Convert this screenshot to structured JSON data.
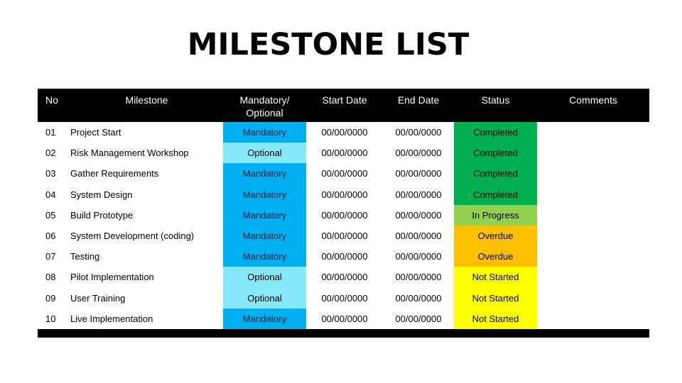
{
  "title": "MILESTONE LIST",
  "colors": {
    "header_bg": "#000000",
    "mandatory": "#00b0f0",
    "optional": "#87e8f7",
    "completed": "#00b050",
    "in_progress": "#92d050",
    "overdue": "#ffc000",
    "not_started": "#ffff00"
  },
  "headers": {
    "no": "No",
    "milestone": "Milestone",
    "mandatory_optional_1": "Mandatory/",
    "mandatory_optional_2": "Optional",
    "start_date": "Start Date",
    "end_date": "End Date",
    "status": "Status",
    "comments": "Comments"
  },
  "rows": [
    {
      "no": "01",
      "milestone": "Project Start",
      "type": "Mandatory",
      "start": "00/00/0000",
      "end": "00/00/0000",
      "status": "Completed",
      "comments": ""
    },
    {
      "no": "02",
      "milestone": "Risk Management Workshop",
      "type": "Optional",
      "start": "00/00/0000",
      "end": "00/00/0000",
      "status": "Completed",
      "comments": ""
    },
    {
      "no": "03",
      "milestone": "Gather Requirements",
      "type": "Mandatory",
      "start": "00/00/0000",
      "end": "00/00/0000",
      "status": "Completed",
      "comments": ""
    },
    {
      "no": "04",
      "milestone": "System Design",
      "type": "Mandatory",
      "start": "00/00/0000",
      "end": "00/00/0000",
      "status": "Completed",
      "comments": ""
    },
    {
      "no": "05",
      "milestone": "Build Prototype",
      "type": "Mandatory",
      "start": "00/00/0000",
      "end": "00/00/0000",
      "status": "In Progress",
      "comments": ""
    },
    {
      "no": "06",
      "milestone": "System Development (coding)",
      "type": "Mandatory",
      "start": "00/00/0000",
      "end": "00/00/0000",
      "status": "Overdue",
      "comments": ""
    },
    {
      "no": "07",
      "milestone": "Testing",
      "type": "Mandatory",
      "start": "00/00/0000",
      "end": "00/00/0000",
      "status": "Overdue",
      "comments": ""
    },
    {
      "no": "08",
      "milestone": "Pilot Implementation",
      "type": "Optional",
      "start": "00/00/0000",
      "end": "00/00/0000",
      "status": "Not Started",
      "comments": ""
    },
    {
      "no": "09",
      "milestone": "User Training",
      "type": "Optional",
      "start": "00/00/0000",
      "end": "00/00/0000",
      "status": "Not Started",
      "comments": ""
    },
    {
      "no": "10",
      "milestone": "Live Implementation",
      "type": "Mandatory",
      "start": "00/00/0000",
      "end": "00/00/0000",
      "status": "Not Started",
      "comments": ""
    }
  ]
}
